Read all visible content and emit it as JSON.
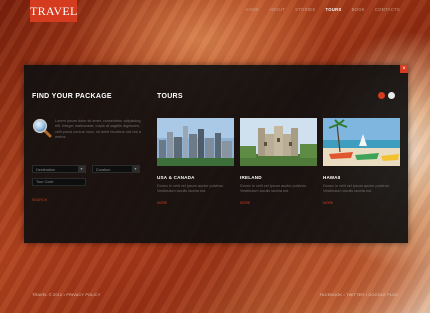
{
  "header": {
    "logo": "TRAVEL",
    "nav": [
      "HOME",
      "ABOUT",
      "STORIES",
      "TOURS",
      "BOOK",
      "CONTACTS"
    ],
    "active_index": 3
  },
  "panel": {
    "close_label": "×",
    "find": {
      "heading": "FIND YOUR PACKAGE",
      "intro": "Lorem ipsum dolor sit amet, consectetur adipiscing elit. Integer malesuada, turpis at sagittis dignissim, velit purus cursus nunc, sit amet faucibus nisl nisi a metus.",
      "destination": "Destination",
      "duration": "Duration",
      "tour_code_placeholder": "Tour Code",
      "search_label": "SEARCH"
    },
    "tours": {
      "heading": "TOURS",
      "items": [
        {
          "title": "USA & CANADA",
          "desc": "Donec in velit vel ipsum auctor pulvinar. Vestibulum iaculis lacinia est.",
          "more": "MORE"
        },
        {
          "title": "IRELAND",
          "desc": "Donec in velit vel ipsum auctor pulvinar. Vestibulum iaculis lacinia est.",
          "more": "MORE"
        },
        {
          "title": "HAWAII",
          "desc": "Donec in velit vel ipsum auctor pulvinar. Vestibulum iaculis lacinia est.",
          "more": "MORE"
        }
      ]
    }
  },
  "footer": {
    "left": "TRAVEL © 2012 • PRIVACY POLICY",
    "right": "FACEBOOK • TWITTER • GOOGLE PLUS"
  },
  "colors": {
    "accent": "#d53b1f",
    "panel": "#101010"
  }
}
